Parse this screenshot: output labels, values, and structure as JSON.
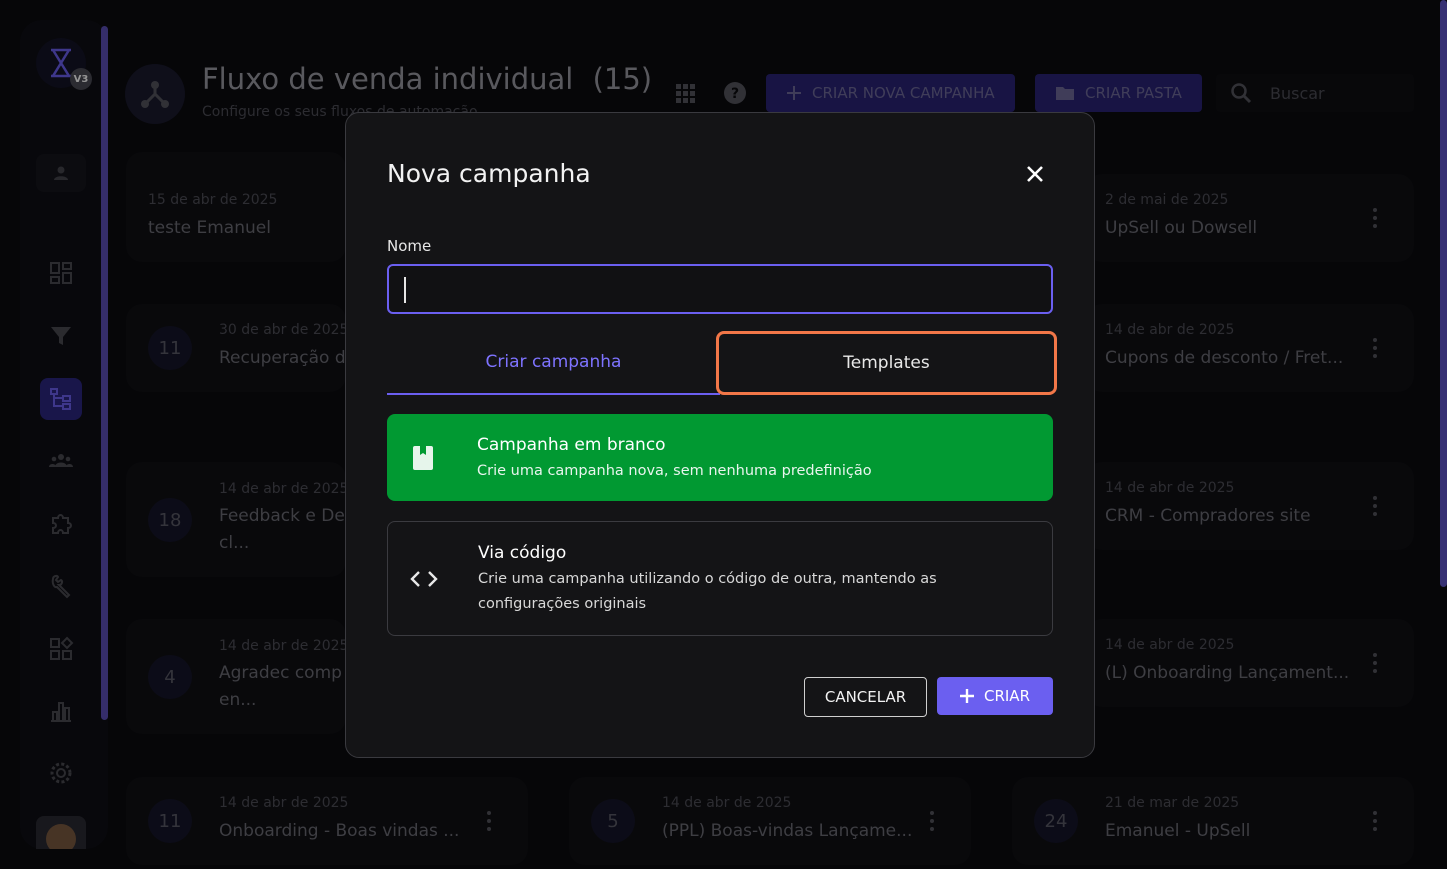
{
  "sidebar": {
    "version_badge": "V3",
    "nav": [
      "dashboard",
      "funnel",
      "flows",
      "audience",
      "integrations",
      "tools",
      "apps",
      "reports",
      "settings"
    ]
  },
  "header": {
    "title": "Fluxo de venda individual",
    "count": "(15)",
    "subtitle": "Configure os seus fluxos de automação",
    "create_campaign_label": "CRIAR NOVA CAMPANHA",
    "create_folder_label": "CRIAR PASTA",
    "search_placeholder": "Buscar"
  },
  "cards": [
    {
      "date": "15 de abr de 2025",
      "name": "teste Emanuel",
      "name2": "",
      "count": ""
    },
    {
      "date": "2 de mai de 2025",
      "name": "UpSell ou Dowsell",
      "name2": "",
      "count": ""
    },
    {
      "date": "30 de abr de 2025",
      "name": "Recuperação d",
      "name2": "",
      "count": "11"
    },
    {
      "date": "14 de abr de 2025",
      "name": "Cupons de desconto / Fret...",
      "name2": "",
      "count": ""
    },
    {
      "date": "14 de abr de 2025",
      "name": "Feedback e De",
      "name2": "cl...",
      "count": "18"
    },
    {
      "date": "14 de abr de 2025",
      "name": "CRM - Compradores site",
      "name2": "",
      "count": ""
    },
    {
      "date": "14 de abr de 2025",
      "name": "Agradec comp",
      "name2": "en...",
      "count": "4"
    },
    {
      "date": "14 de abr de 2025",
      "name": "(L) Onboarding Lançament...",
      "name2": "",
      "count": ""
    },
    {
      "date": "14 de abr de 2025",
      "name": "Onboarding - Boas vindas ...",
      "name2": "",
      "count": "11"
    },
    {
      "date": "14 de abr de 2025",
      "name": "(PPL) Boas-vindas Lançame...",
      "name2": "",
      "count": "5"
    },
    {
      "date": "21 de mar de 2025",
      "name": "Emanuel - UpSell",
      "name2": "",
      "count": "24"
    }
  ],
  "modal": {
    "title": "Nova campanha",
    "name_label": "Nome",
    "name_value": "",
    "tabs": {
      "create": "Criar campanha",
      "templates": "Templates"
    },
    "options": {
      "blank": {
        "title": "Campanha em branco",
        "desc": "Crie uma campanha nova, sem nenhuma predefinição"
      },
      "code": {
        "title": "Via código",
        "desc": "Crie uma campanha utilizando o código de outra, mantendo as configurações originais"
      }
    },
    "cancel_label": "CANCELAR",
    "create_label": "CRIAR"
  },
  "colors": {
    "accent": "#6b5ff0",
    "green": "#019932",
    "highlight": "#f27748"
  }
}
